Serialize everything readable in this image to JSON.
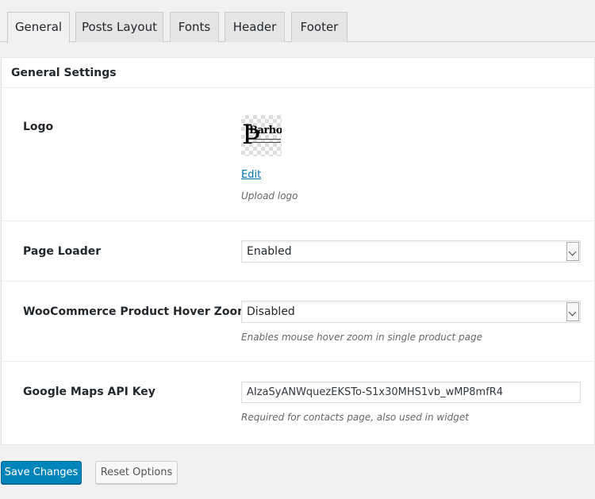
{
  "tabs": [
    {
      "label": "General",
      "active": true
    },
    {
      "label": "Posts Layout",
      "active": false
    },
    {
      "label": "Fonts",
      "active": false
    },
    {
      "label": "Header",
      "active": false
    },
    {
      "label": "Footer",
      "active": false
    }
  ],
  "section_title": "General Settings",
  "logo": {
    "label": "Logo",
    "image_text": "Barhous",
    "edit_link": "Edit",
    "description": "Upload logo"
  },
  "page_loader": {
    "label": "Page Loader",
    "selected": "Enabled"
  },
  "hover_zoom": {
    "label": "WooCommerce Product Hover Zoom",
    "selected": "Disabled",
    "description": "Enables mouse hover zoom in single product page"
  },
  "maps_key": {
    "label": "Google Maps API Key",
    "value": "AIzaSyANWquezEKSTo-S1x30MHS1vb_wMP8mfR4",
    "description": "Required for contacts page, also used in widget"
  },
  "buttons": {
    "save": "Save Changes",
    "reset": "Reset Options"
  },
  "colors": {
    "primary": "#0085ba",
    "link": "#0073aa"
  }
}
